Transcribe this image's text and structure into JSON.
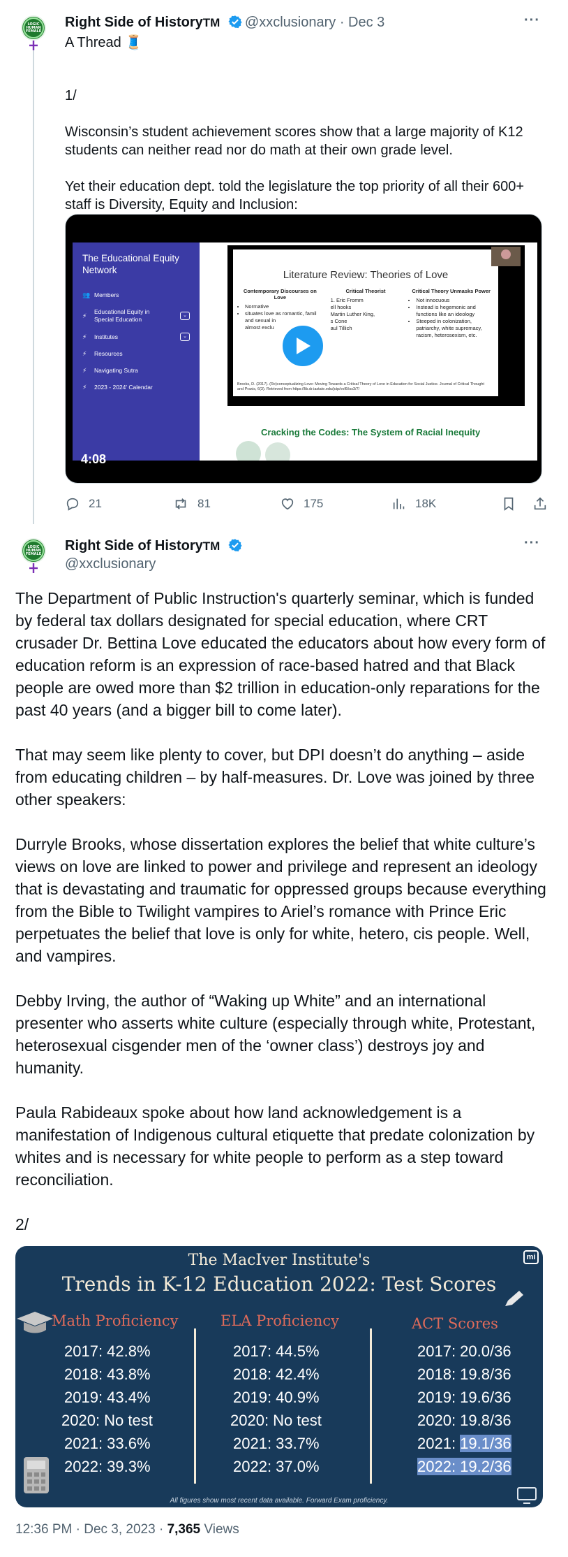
{
  "tweet1": {
    "display_name": "Right Side of History",
    "tm": "TM",
    "handle": "@xxclusionary",
    "separator": "·",
    "date": "Dec 3",
    "paragraphs": [
      "A Thread 🧵",
      "",
      "1/",
      "",
      "Wisconsin’s student achievement scores show that a large majority of K12 students can neither read nor do math at their own grade level.",
      "",
      "Yet their education dept. told the legislature the top priority of all their 600+ staff is Diversity, Equity and Inclusion:"
    ],
    "video": {
      "duration": "4:08",
      "sidebar_title": "The Educational Equity Network",
      "sidebar_items": [
        {
          "glyph": "👥",
          "label": "Members",
          "caret": false
        },
        {
          "glyph": "⚡",
          "label": "Educational Equity in Special Education",
          "caret": true
        },
        {
          "glyph": "⚡",
          "label": "Institutes",
          "caret": true
        },
        {
          "glyph": "⚡",
          "label": "Resources",
          "caret": false
        },
        {
          "glyph": "⚡",
          "label": "Navigating Sutra",
          "caret": false
        },
        {
          "glyph": "⚡",
          "label": "2023 - 2024' Calendar",
          "caret": false
        }
      ],
      "slide_title": "Literature Review: Theories of Love",
      "slide_cols": [
        {
          "heading": "Contemporary Discourses on Love",
          "items": [
            "Normative",
            "situates love as romantic, famil",
            "and sexual in",
            "almost exclu"
          ]
        },
        {
          "heading": "Critical Theorist",
          "items": [
            "1. Eric Fromm",
            "ell hooks",
            "Martin Luther King,",
            "s Cone",
            "aul Tillich"
          ]
        },
        {
          "heading": "Critical Theory Unmasks Power",
          "items": [
            "Not innocuous",
            "Instead is hegemonic and functions like an ideology",
            "Steeped in colonization, patriarchy, white supremacy, racism, heterosexism, etc."
          ]
        }
      ],
      "slide_citation": "Brooks, D. (2017). (Re)conceptualizing Love: Moving Towards a Critical Theory of Love in Education for Social Justice. Journal of Critical Thought and Praxis, 6(3). Retrieved from https://lib.dr.iastate.edu/jctp/vol6/iss3/7/",
      "lower_heading": "Cracking the Codes: The System of Racial Inequity"
    },
    "actions": {
      "replies": "21",
      "reposts": "81",
      "likes": "175",
      "views": "18K"
    }
  },
  "tweet2": {
    "display_name": "Right Side of History",
    "tm": "TM",
    "handle": "@xxclusionary",
    "paragraphs": [
      "The Department of Public Instruction's quarterly seminar, which is funded by federal tax dollars designated for special education, where CRT crusader Dr. Bettina Love educated the educators about how every form of education reform is an expression of race-based hatred and that Black people are owed more than $2 trillion in education-only reparations for the past 40 years (and a bigger bill to come later).",
      "That may seem like plenty to cover, but DPI doesn’t do anything – aside from educating children – by half-measures. Dr. Love was joined by three other speakers:",
      "Durryle Brooks, whose dissertation explores the belief that white culture’s views on love are linked to power and privilege and represent an ideology that is devastating and traumatic for oppressed groups because everything from the Bible to Twilight vampires to Ariel’s romance with Prince Eric perpetuates the belief that love is only for white, hetero, cis people. Well, and vampires.",
      "Debby Irving, the author of “Waking up White” and an international presenter who asserts white culture (especially through white, Protestant, heterosexual cisgender men of the ‘owner class’) destroys joy and humanity.",
      "Paula Rabideaux spoke about how land acknowledgement is a manifestation of Indigenous cultural etiquette that predate colonization by whites and is necessary for white people to perform as a step toward reconciliation.",
      "2/"
    ],
    "infographic": {
      "subtitle": "The MacIver Institute's",
      "title": "Trends in K-12 Education 2022: Test Scores",
      "logo": "mi",
      "columns": [
        {
          "heading": "Math Proficiency",
          "rows": [
            "2017: 42.8%",
            "2018: 43.8%",
            "2019: 43.4%",
            "2020: No test",
            "2021: 33.6%",
            "2022: 39.3%"
          ]
        },
        {
          "heading": "ELA Proficiency",
          "rows": [
            "2017: 44.5%",
            "2018: 42.4%",
            "2019: 40.9%",
            "2020: No test",
            "2021: 33.7%",
            "2022: 37.0%"
          ]
        },
        {
          "heading": "ACT Scores",
          "rows": [
            "2017: 20.0/36",
            "2018: 19.8/36",
            "2019: 19.6/36",
            "2020: 19.8/36",
            "2021: ",
            "2022: 19.2/36"
          ],
          "highlight_2021": "19.1/36"
        }
      ],
      "footnote": "All figures show most recent data available. Forward Exam proficiency."
    },
    "footer": {
      "time": "12:36 PM",
      "separator": "·",
      "date": "Dec 3, 2023",
      "views_count": "7,365",
      "views_label": "Views"
    }
  },
  "colors": {
    "verified_blue": "#1d9bf0",
    "text_primary": "#0f1419",
    "text_secondary": "#536471",
    "infographic_bg": "#183a5a"
  }
}
